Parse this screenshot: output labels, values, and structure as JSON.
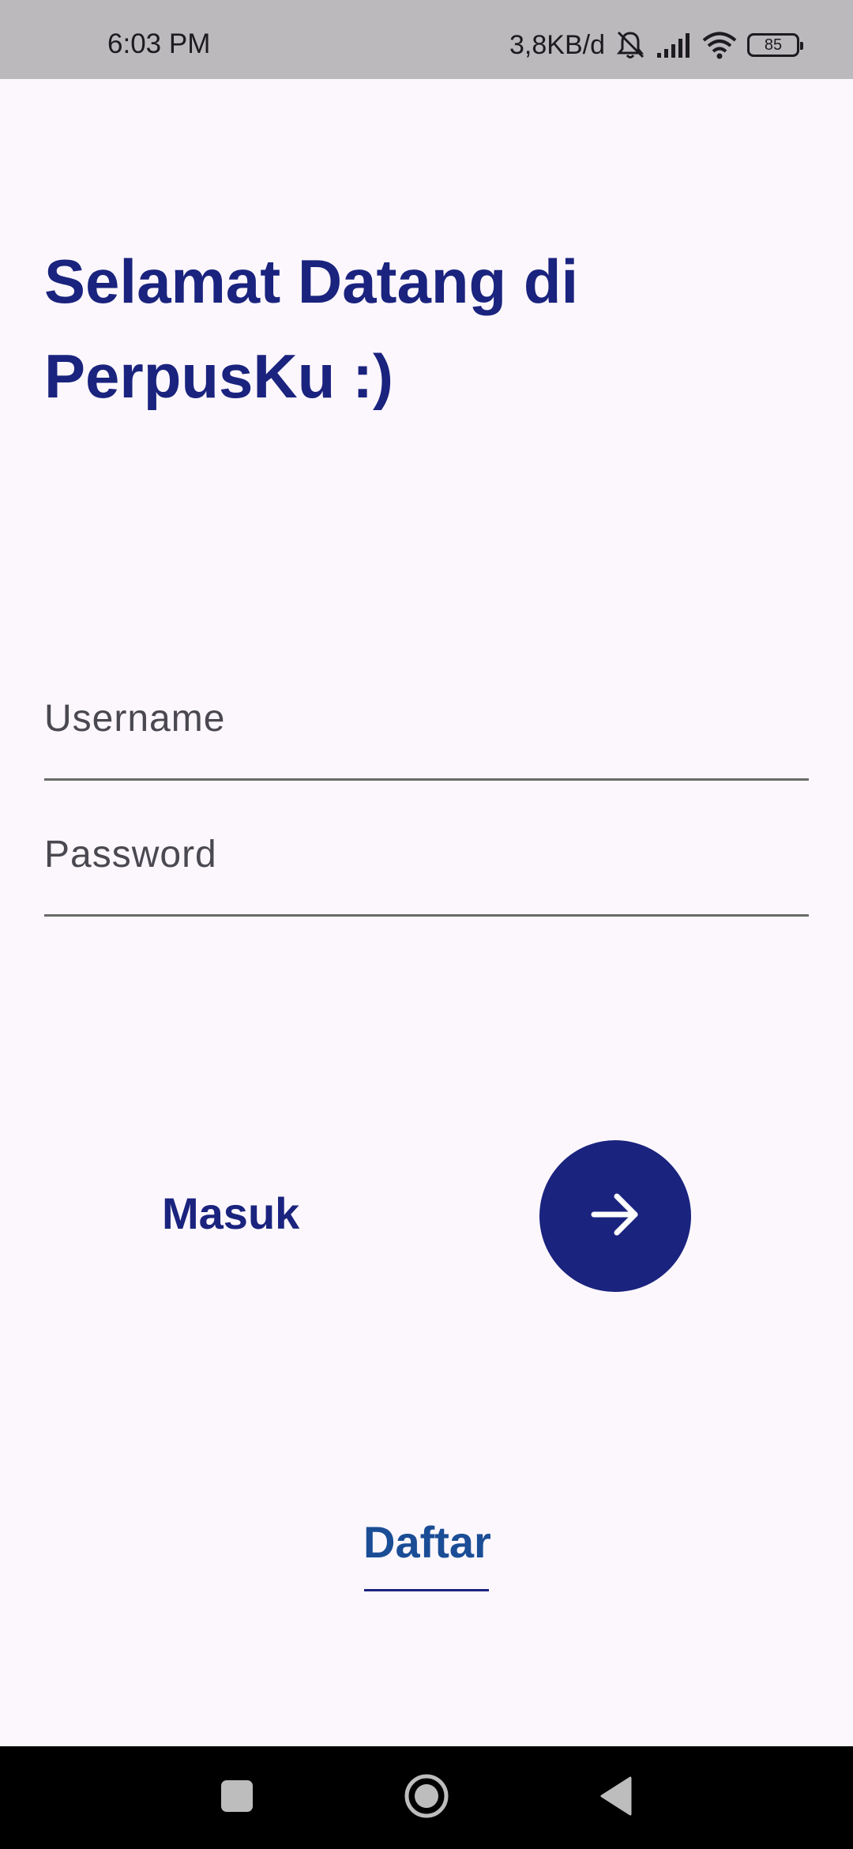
{
  "status_bar": {
    "time": "6:03 PM",
    "net_speed": "3,8KB/d",
    "battery_level": "85",
    "icons": [
      "notification-off-icon",
      "signal-icon",
      "wifi-icon",
      "battery-icon"
    ]
  },
  "welcome": {
    "title": "Selamat Datang di PerpusKu :)"
  },
  "form": {
    "username_placeholder": "Username",
    "username_value": "",
    "password_placeholder": "Password",
    "password_value": ""
  },
  "login": {
    "label": "Masuk",
    "button_icon": "arrow-right-icon",
    "button_color": "#1a237e"
  },
  "register": {
    "label": "Daftar"
  },
  "nav_bar": {
    "icons": [
      "recents-icon",
      "home-icon",
      "back-icon"
    ]
  },
  "colors": {
    "primary": "#1a237e",
    "link": "#1a4d96",
    "background": "#fcf7fd",
    "status_bar": "#bcb9bd"
  }
}
